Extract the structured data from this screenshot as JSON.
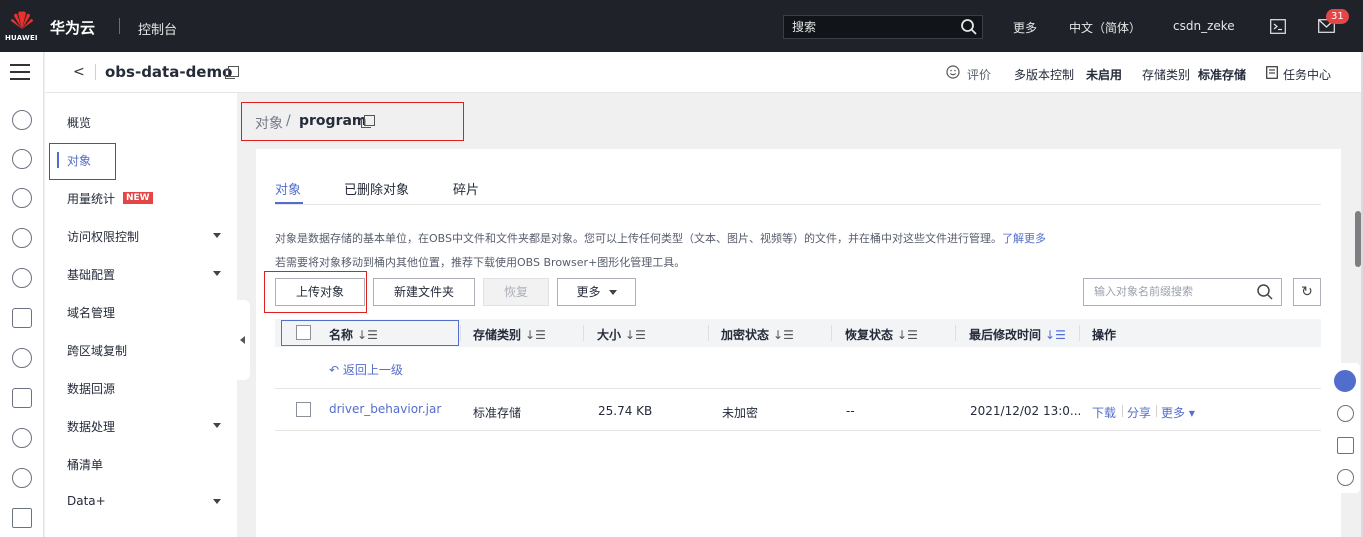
{
  "topbar": {
    "logo_text": "HUAWEI",
    "brand": "华为云",
    "console": "控制台",
    "search_placeholder": "搜索",
    "more": "更多",
    "language": "中文（简体）",
    "user": "csdn_zeke",
    "badge_count": "31"
  },
  "subheader": {
    "back": "<",
    "bucket_name": "obs-data-demo",
    "rating": "评价",
    "versioning_label": "多版本控制",
    "versioning_value": "未启用",
    "storage_label": "存储类别",
    "storage_value": "标准存储",
    "tasks": "任务中心"
  },
  "sidebar": {
    "items": [
      {
        "label": "概览"
      },
      {
        "label": "对象"
      },
      {
        "label": "用量统计"
      },
      {
        "label": "访问权限控制"
      },
      {
        "label": "基础配置"
      },
      {
        "label": "域名管理"
      },
      {
        "label": "跨区域复制"
      },
      {
        "label": "数据回源"
      },
      {
        "label": "数据处理"
      },
      {
        "label": "桶清单"
      },
      {
        "label": "Data+"
      }
    ],
    "new_badge": "NEW"
  },
  "breadcrumb": {
    "root": "对象",
    "sep": "/",
    "current": "program"
  },
  "tabs": [
    {
      "label": "对象"
    },
    {
      "label": "已删除对象"
    },
    {
      "label": "碎片"
    }
  ],
  "description": {
    "line1": "对象是数据存储的基本单位，在OBS中文件和文件夹都是对象。您可以上传任何类型（文本、图片、视频等）的文件，并在桶中对这些文件进行管理。",
    "line1_link": "了解更多",
    "line2": "若需要将对象移动到桶内其他位置，推荐下载使用OBS Browser+图形化管理工具。"
  },
  "toolbar": {
    "upload": "上传对象",
    "new_folder": "新建文件夹",
    "restore": "恢复",
    "more": "更多",
    "filter_placeholder": "输入对象名前缀搜索"
  },
  "table": {
    "headers": {
      "name": "名称",
      "storage": "存储类别",
      "size": "大小",
      "encryption": "加密状态",
      "restore": "恢复状态",
      "modified": "最后修改时间",
      "actions": "操作"
    },
    "back_link": "返回上一级",
    "rows": [
      {
        "name": "driver_behavior.jar",
        "storage": "标准存储",
        "size": "25.74 KB",
        "encryption": "未加密",
        "restore": "--",
        "modified": "2021/12/02 13:0...",
        "action_download": "下载",
        "action_share": "分享",
        "action_more": "更多"
      }
    ]
  }
}
